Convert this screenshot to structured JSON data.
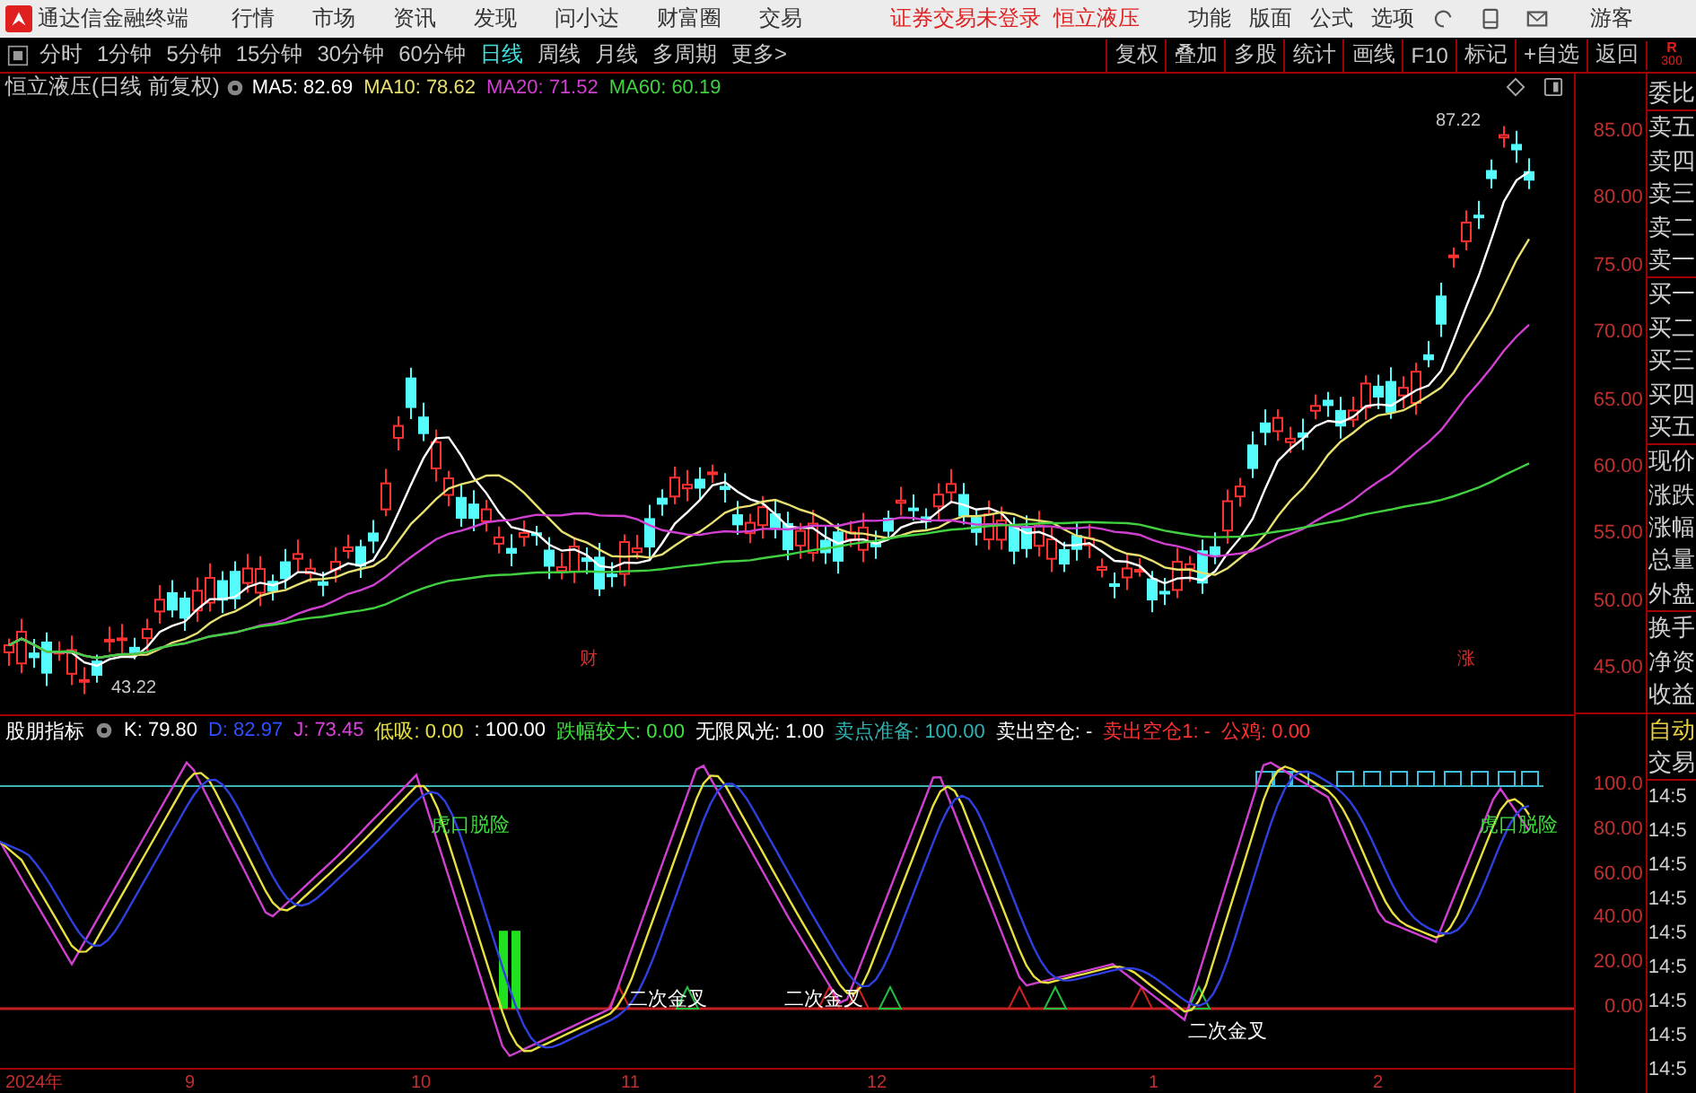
{
  "app": {
    "title": "通达信金融终端",
    "menu": [
      "行情",
      "市场",
      "资讯",
      "发现",
      "问小达",
      "财富圈",
      "交易"
    ],
    "notice": [
      "证券交易未登录",
      "恒立液压"
    ],
    "tools": [
      "功能",
      "版面",
      "公式",
      "选项"
    ],
    "user": "游客"
  },
  "periods": [
    {
      "label": "分时",
      "selected": false
    },
    {
      "label": "1分钟",
      "selected": false
    },
    {
      "label": "5分钟",
      "selected": false
    },
    {
      "label": "15分钟",
      "selected": false
    },
    {
      "label": "30分钟",
      "selected": false
    },
    {
      "label": "60分钟",
      "selected": false
    },
    {
      "label": "日线",
      "selected": true
    },
    {
      "label": "周线",
      "selected": false
    },
    {
      "label": "月线",
      "selected": false
    },
    {
      "label": "多周期",
      "selected": false
    },
    {
      "label": "更多>",
      "selected": false
    }
  ],
  "actions": [
    "复权",
    "叠加",
    "多股",
    "统计",
    "画线",
    "F10",
    "标记",
    "+自选",
    "返回"
  ],
  "corner": [
    "R",
    "300"
  ],
  "main_chart": {
    "title": "恒立液压(日线 前复权)",
    "ma": [
      {
        "label": "MA5: 82.69",
        "color": "#ffffff"
      },
      {
        "label": "MA10: 78.62",
        "color": "#e8e070"
      },
      {
        "label": "MA20: 71.52",
        "color": "#d040d0"
      },
      {
        "label": "MA60: 60.19",
        "color": "#40d040"
      }
    ],
    "high_label": "87.22",
    "low_label": "43.22",
    "markers": [
      "财",
      "涨"
    ],
    "yticks": [
      "85.00",
      "80.00",
      "75.00",
      "70.00",
      "65.00",
      "60.00",
      "55.00",
      "50.00",
      "45.00"
    ]
  },
  "indicator": {
    "items": [
      {
        "label": "股朋指标",
        "color": "#ffffff"
      },
      {
        "label": "K: 79.80",
        "color": "#ffffff"
      },
      {
        "label": "D: 82.97",
        "color": "#3050ff"
      },
      {
        "label": "J: 73.45",
        "color": "#e040e0"
      },
      {
        "label": "低吸: 0.00",
        "color": "#e8e040"
      },
      {
        "label": ": 100.00",
        "color": "#ffffff"
      },
      {
        "label": "跌幅较大: 0.00",
        "color": "#40e040"
      },
      {
        "label": "无限风光: 1.00",
        "color": "#ffffff"
      },
      {
        "label": "卖点准备: 100.00",
        "color": "#30b0b0"
      },
      {
        "label": "卖出空仓: -",
        "color": "#ffffff"
      },
      {
        "label": "卖出空仓1: -",
        "color": "#ff3030"
      },
      {
        "label": "公鸡: 0.00",
        "color": "#ff3030"
      }
    ],
    "signals": [
      "虎口脱险",
      "虎口脱险"
    ],
    "crosses": [
      "二次金叉",
      "二次金叉",
      "二次金叉"
    ],
    "yticks": [
      "100.0",
      "80.00",
      "60.00",
      "40.00",
      "20.00",
      "0.00"
    ]
  },
  "quote_labels": [
    "委比",
    "卖五",
    "卖四",
    "卖三",
    "卖二",
    "卖一",
    "买一",
    "买二",
    "买三",
    "买四",
    "买五",
    "现价",
    "涨跌",
    "涨幅",
    "总量",
    "外盘",
    "换手",
    "净资",
    "收益"
  ],
  "trade_panel": {
    "title": "自动",
    "subtitle": "交易",
    "times": [
      "14:5",
      "14:5",
      "14:5",
      "14:5",
      "14:5",
      "14:5",
      "14:5",
      "14:5",
      "14:5"
    ]
  },
  "time_axis": [
    "2024年",
    "9",
    "10",
    "11",
    "12",
    "1",
    "2"
  ]
}
